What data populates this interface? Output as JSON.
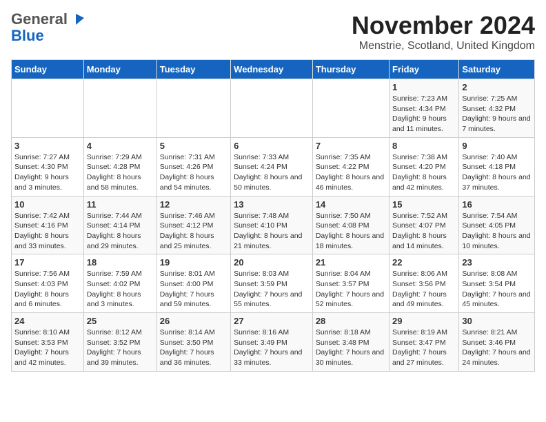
{
  "logo": {
    "general": "General",
    "blue": "Blue"
  },
  "header": {
    "month": "November 2024",
    "location": "Menstrie, Scotland, United Kingdom"
  },
  "days_of_week": [
    "Sunday",
    "Monday",
    "Tuesday",
    "Wednesday",
    "Thursday",
    "Friday",
    "Saturday"
  ],
  "weeks": [
    [
      {
        "day": "",
        "info": ""
      },
      {
        "day": "",
        "info": ""
      },
      {
        "day": "",
        "info": ""
      },
      {
        "day": "",
        "info": ""
      },
      {
        "day": "",
        "info": ""
      },
      {
        "day": "1",
        "info": "Sunrise: 7:23 AM\nSunset: 4:34 PM\nDaylight: 9 hours and 11 minutes."
      },
      {
        "day": "2",
        "info": "Sunrise: 7:25 AM\nSunset: 4:32 PM\nDaylight: 9 hours and 7 minutes."
      }
    ],
    [
      {
        "day": "3",
        "info": "Sunrise: 7:27 AM\nSunset: 4:30 PM\nDaylight: 9 hours and 3 minutes."
      },
      {
        "day": "4",
        "info": "Sunrise: 7:29 AM\nSunset: 4:28 PM\nDaylight: 8 hours and 58 minutes."
      },
      {
        "day": "5",
        "info": "Sunrise: 7:31 AM\nSunset: 4:26 PM\nDaylight: 8 hours and 54 minutes."
      },
      {
        "day": "6",
        "info": "Sunrise: 7:33 AM\nSunset: 4:24 PM\nDaylight: 8 hours and 50 minutes."
      },
      {
        "day": "7",
        "info": "Sunrise: 7:35 AM\nSunset: 4:22 PM\nDaylight: 8 hours and 46 minutes."
      },
      {
        "day": "8",
        "info": "Sunrise: 7:38 AM\nSunset: 4:20 PM\nDaylight: 8 hours and 42 minutes."
      },
      {
        "day": "9",
        "info": "Sunrise: 7:40 AM\nSunset: 4:18 PM\nDaylight: 8 hours and 37 minutes."
      }
    ],
    [
      {
        "day": "10",
        "info": "Sunrise: 7:42 AM\nSunset: 4:16 PM\nDaylight: 8 hours and 33 minutes."
      },
      {
        "day": "11",
        "info": "Sunrise: 7:44 AM\nSunset: 4:14 PM\nDaylight: 8 hours and 29 minutes."
      },
      {
        "day": "12",
        "info": "Sunrise: 7:46 AM\nSunset: 4:12 PM\nDaylight: 8 hours and 25 minutes."
      },
      {
        "day": "13",
        "info": "Sunrise: 7:48 AM\nSunset: 4:10 PM\nDaylight: 8 hours and 21 minutes."
      },
      {
        "day": "14",
        "info": "Sunrise: 7:50 AM\nSunset: 4:08 PM\nDaylight: 8 hours and 18 minutes."
      },
      {
        "day": "15",
        "info": "Sunrise: 7:52 AM\nSunset: 4:07 PM\nDaylight: 8 hours and 14 minutes."
      },
      {
        "day": "16",
        "info": "Sunrise: 7:54 AM\nSunset: 4:05 PM\nDaylight: 8 hours and 10 minutes."
      }
    ],
    [
      {
        "day": "17",
        "info": "Sunrise: 7:56 AM\nSunset: 4:03 PM\nDaylight: 8 hours and 6 minutes."
      },
      {
        "day": "18",
        "info": "Sunrise: 7:59 AM\nSunset: 4:02 PM\nDaylight: 8 hours and 3 minutes."
      },
      {
        "day": "19",
        "info": "Sunrise: 8:01 AM\nSunset: 4:00 PM\nDaylight: 7 hours and 59 minutes."
      },
      {
        "day": "20",
        "info": "Sunrise: 8:03 AM\nSunset: 3:59 PM\nDaylight: 7 hours and 55 minutes."
      },
      {
        "day": "21",
        "info": "Sunrise: 8:04 AM\nSunset: 3:57 PM\nDaylight: 7 hours and 52 minutes."
      },
      {
        "day": "22",
        "info": "Sunrise: 8:06 AM\nSunset: 3:56 PM\nDaylight: 7 hours and 49 minutes."
      },
      {
        "day": "23",
        "info": "Sunrise: 8:08 AM\nSunset: 3:54 PM\nDaylight: 7 hours and 45 minutes."
      }
    ],
    [
      {
        "day": "24",
        "info": "Sunrise: 8:10 AM\nSunset: 3:53 PM\nDaylight: 7 hours and 42 minutes."
      },
      {
        "day": "25",
        "info": "Sunrise: 8:12 AM\nSunset: 3:52 PM\nDaylight: 7 hours and 39 minutes."
      },
      {
        "day": "26",
        "info": "Sunrise: 8:14 AM\nSunset: 3:50 PM\nDaylight: 7 hours and 36 minutes."
      },
      {
        "day": "27",
        "info": "Sunrise: 8:16 AM\nSunset: 3:49 PM\nDaylight: 7 hours and 33 minutes."
      },
      {
        "day": "28",
        "info": "Sunrise: 8:18 AM\nSunset: 3:48 PM\nDaylight: 7 hours and 30 minutes."
      },
      {
        "day": "29",
        "info": "Sunrise: 8:19 AM\nSunset: 3:47 PM\nDaylight: 7 hours and 27 minutes."
      },
      {
        "day": "30",
        "info": "Sunrise: 8:21 AM\nSunset: 3:46 PM\nDaylight: 7 hours and 24 minutes."
      }
    ]
  ]
}
